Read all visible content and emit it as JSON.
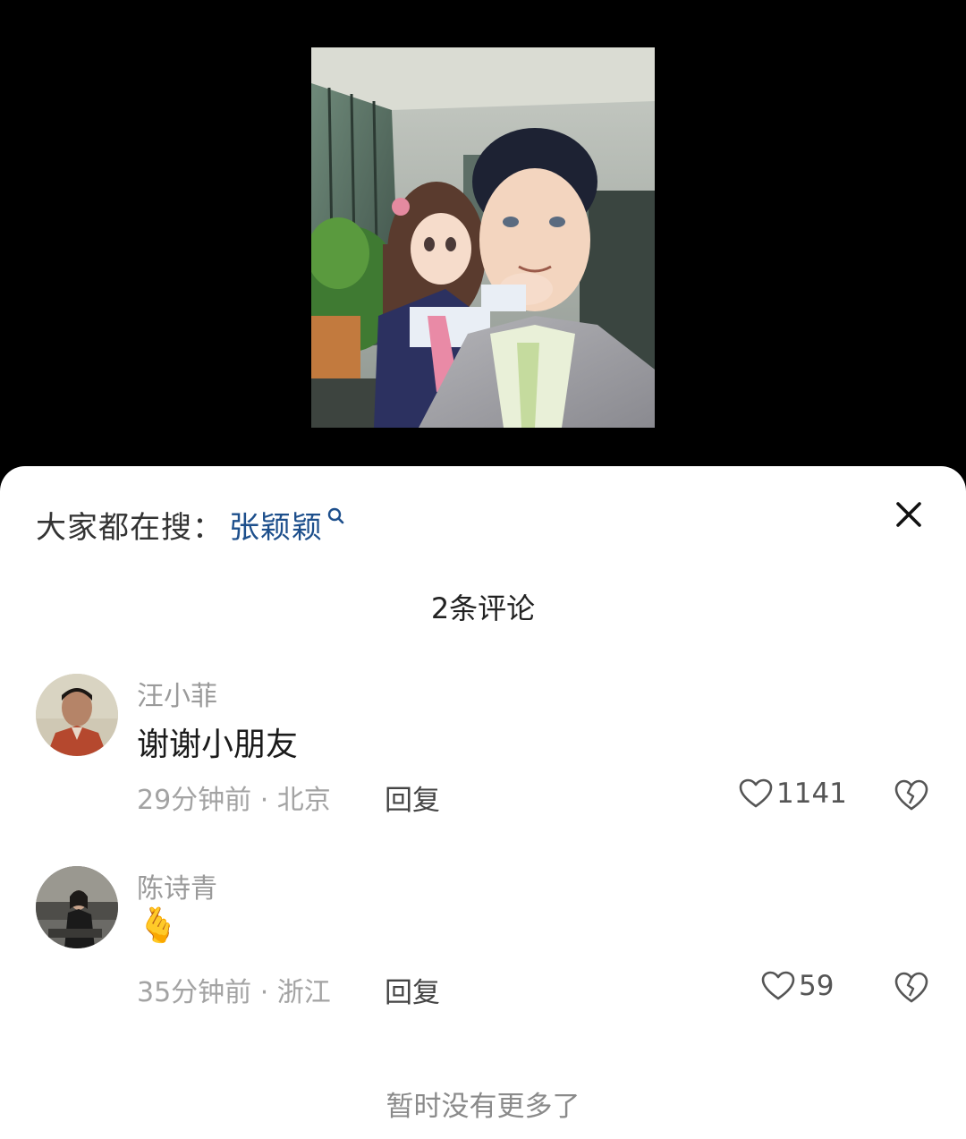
{
  "search_bar": {
    "prefix": "大家都在搜：",
    "term": "张颖颖",
    "search_icon": "search-icon"
  },
  "sheet": {
    "comment_count": "2条评论",
    "no_more_text": "暂时没有更多了",
    "close_icon": "close-icon"
  },
  "comments": [
    {
      "username": "汪小菲",
      "text": "谢谢小朋友",
      "meta": "29分钟前 · 北京",
      "reply_label": "回复",
      "likes": "1141"
    },
    {
      "username": "陈诗青",
      "text": "🫰",
      "meta": "35分钟前 · 浙江",
      "reply_label": "回复",
      "likes": "59"
    }
  ],
  "colors": {
    "search_term": "#1d4f8c",
    "background_top": "#000000",
    "sheet": "#ffffff"
  }
}
